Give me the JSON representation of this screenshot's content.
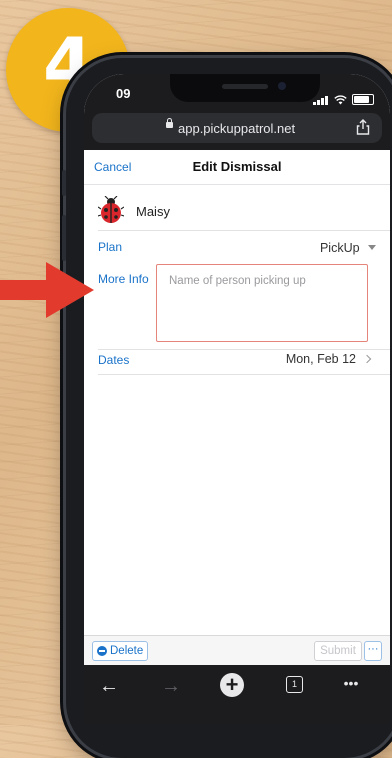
{
  "step_badge": {
    "number": "4"
  },
  "status_bar": {
    "time": "09"
  },
  "browser": {
    "url": "app.pickuppatrol.net"
  },
  "nav": {
    "cancel_label": "Cancel",
    "title": "Edit Dismissal"
  },
  "student": {
    "name": "Maisy",
    "icon": "ladybug-icon"
  },
  "form": {
    "plan": {
      "label": "Plan",
      "value": "PickUp"
    },
    "more_info": {
      "label": "More Info",
      "placeholder": "Name of person picking up"
    },
    "dates": {
      "label": "Dates",
      "value": "Mon, Feb 12"
    }
  },
  "actions": {
    "delete_label": "Delete",
    "submit_label": "Submit",
    "more_label": "···"
  },
  "toolbar": {
    "back": "←",
    "forward": "→",
    "tabs_count": "1",
    "menu": "•••"
  },
  "colors": {
    "accent": "#1a73c9",
    "highlight": "#e5847b",
    "badge": "#f2b51c",
    "arrow": "#e23b2e"
  }
}
